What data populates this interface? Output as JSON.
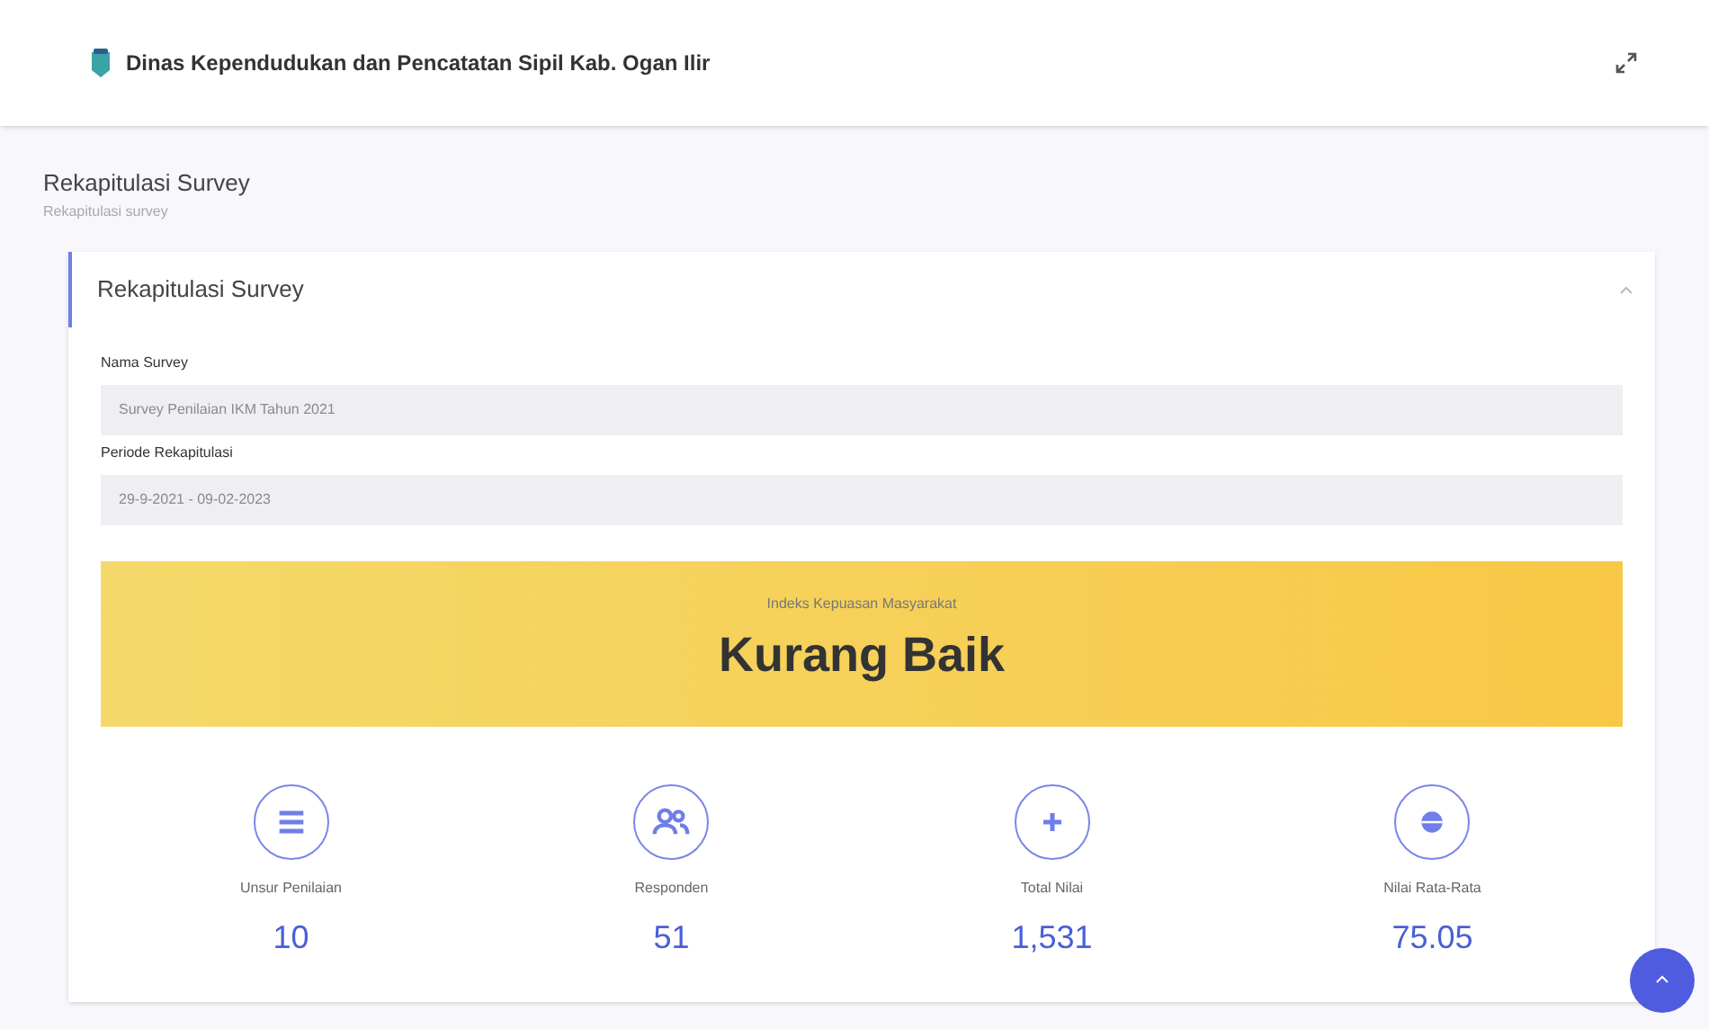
{
  "header": {
    "title": "Dinas Kependudukan dan Pencatatan Sipil Kab. Ogan Ilir"
  },
  "page": {
    "title": "Rekapitulasi Survey",
    "subtitle": "Rekapitulasi survey"
  },
  "card": {
    "title": "Rekapitulasi Survey",
    "expanded": true,
    "fields": [
      {
        "label": "Nama Survey",
        "value": "Survey Penilaian IKM Tahun 2021"
      },
      {
        "label": "Periode Rekapitulasi",
        "value": "29-9-2021 - 09-02-2023"
      }
    ],
    "index": {
      "label": "Indeks Kepuasan Masyarakat",
      "value": "Kurang Baik"
    },
    "stats": [
      {
        "kind": "list",
        "label": "Unsur Penilaian",
        "value": "10"
      },
      {
        "kind": "users",
        "label": "Responden",
        "value": "51"
      },
      {
        "kind": "plus",
        "label": "Total Nilai",
        "value": "1,531"
      },
      {
        "kind": "globe",
        "label": "Nilai Rata-Rata",
        "value": "75.05"
      }
    ]
  }
}
